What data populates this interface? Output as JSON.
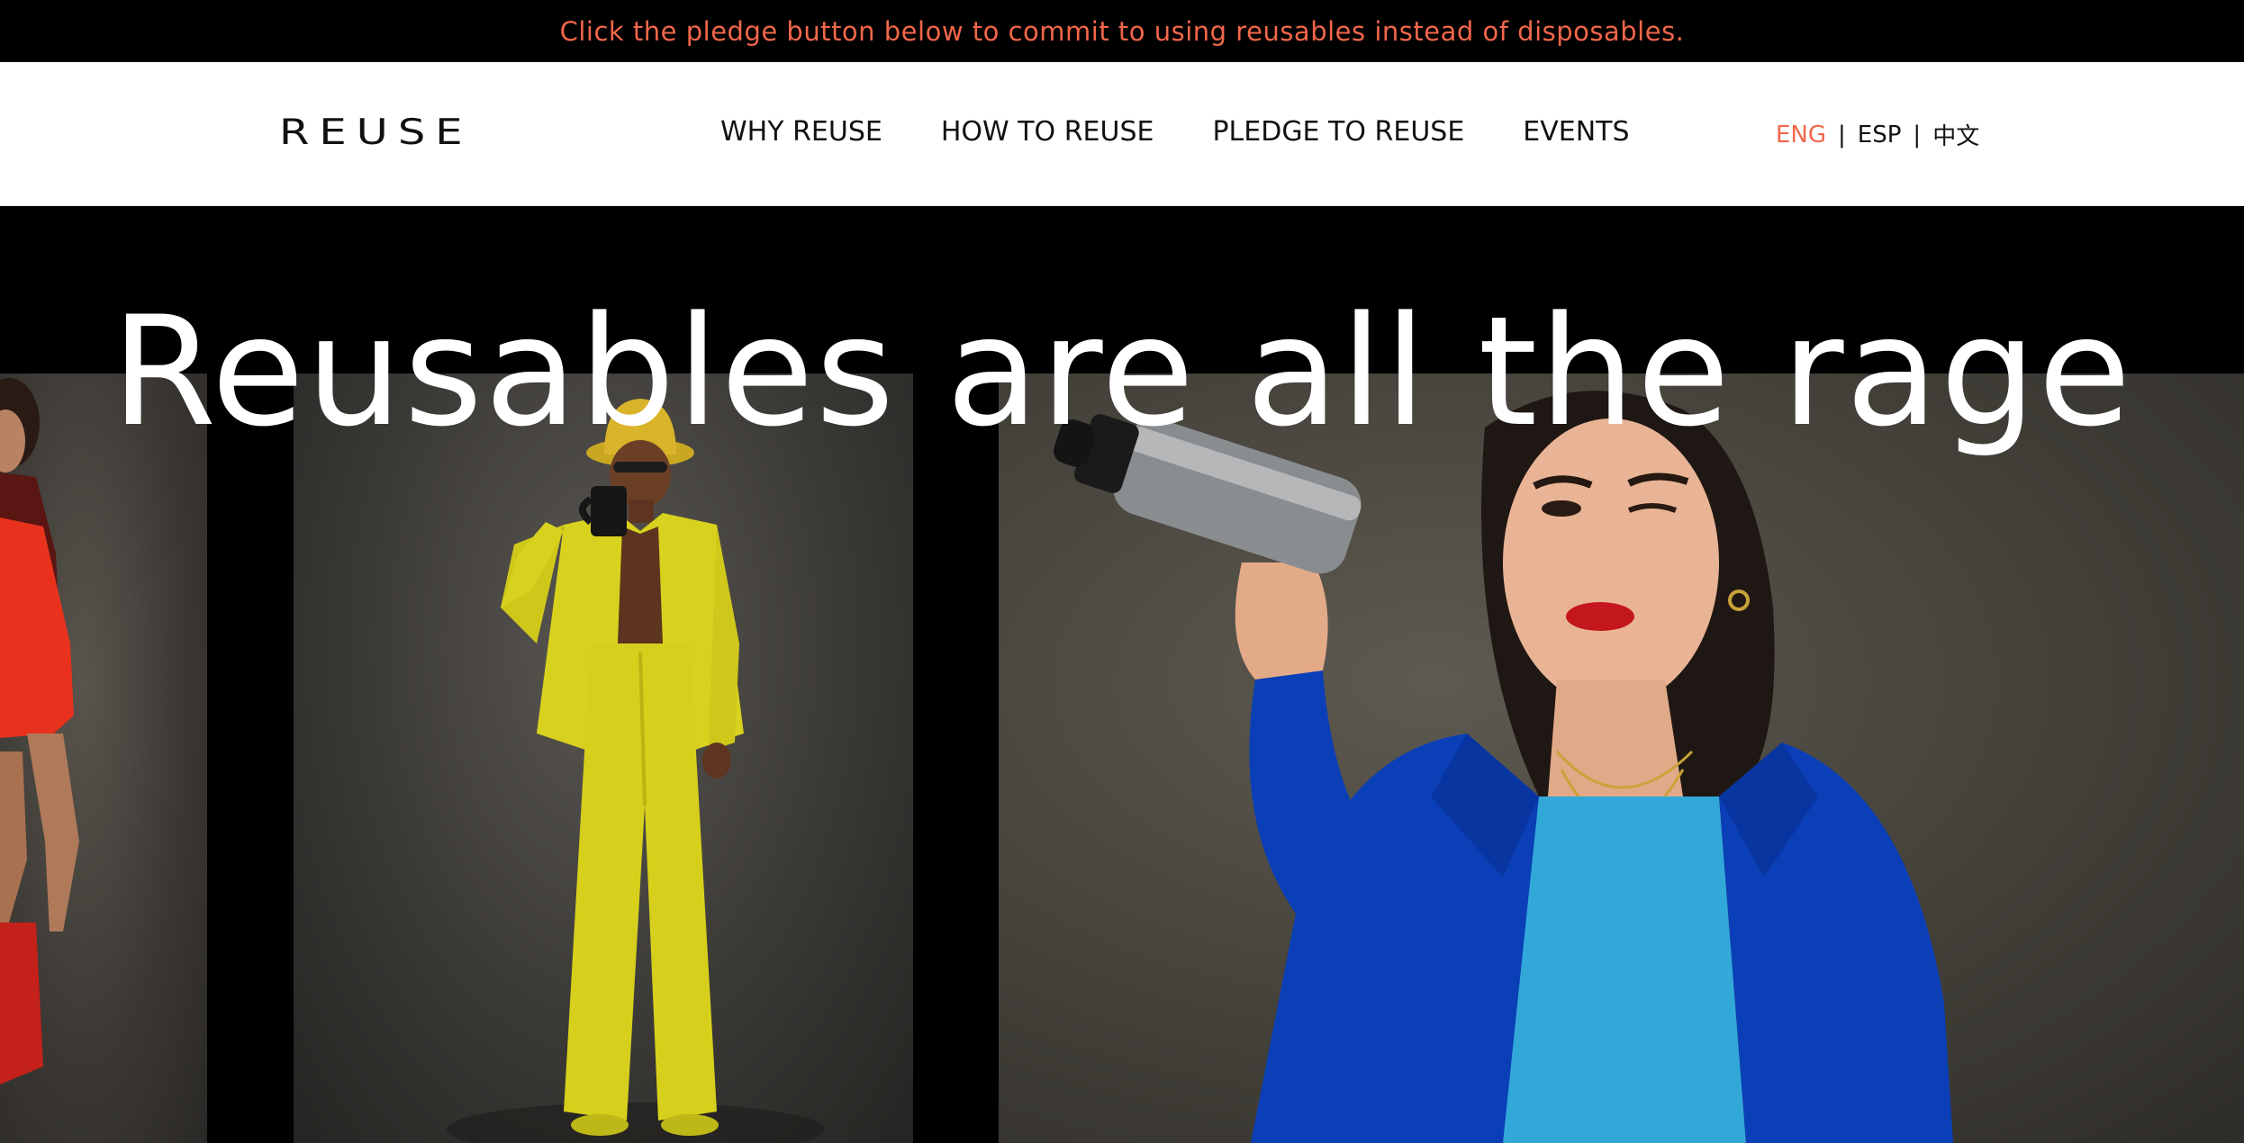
{
  "announcement": {
    "text": "Click the pledge button below to commit to using reusables instead of disposables."
  },
  "nav": {
    "logo": "REUSE",
    "items": [
      {
        "label": "WHY REUSE"
      },
      {
        "label": "HOW TO REUSE"
      },
      {
        "label": "PLEDGE TO REUSE"
      },
      {
        "label": "EVENTS"
      }
    ],
    "languages": {
      "active": "ENG",
      "others": [
        "ESP",
        "中文"
      ],
      "separator": "|"
    }
  },
  "hero": {
    "title": "Reusables are all the rage",
    "photos": [
      "person-in-red-dress-photo",
      "person-in-yellow-suit-with-mug-photo",
      "woman-in-blue-jacket-with-water-bottle-photo"
    ]
  },
  "colors": {
    "accent": "#f2674a",
    "announcement_bg": "#000000",
    "nav_bg": "#ffffff",
    "hero_bg": "#000000",
    "yellow_suit": "#d8d21e",
    "blue_jacket": "#0a3fb8",
    "red_dress": "#e8321e"
  }
}
